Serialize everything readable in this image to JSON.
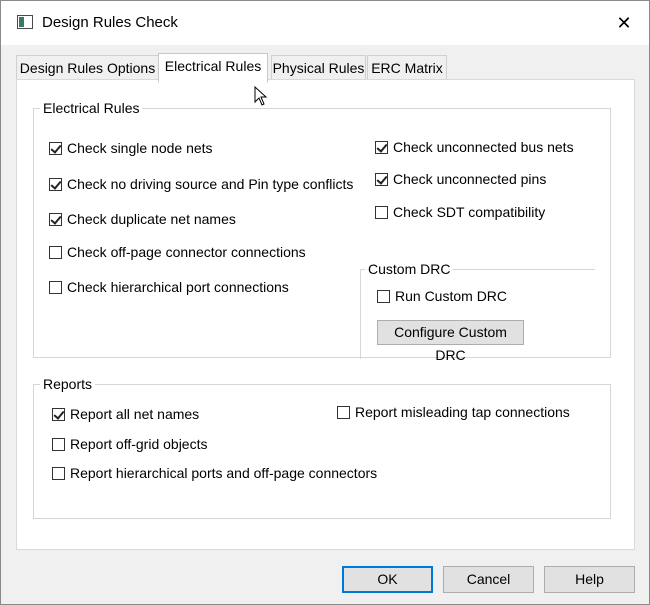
{
  "window": {
    "title": "Design Rules Check",
    "close_glyph": "✕"
  },
  "tabs": [
    {
      "label": "Design Rules Options"
    },
    {
      "label": "Electrical Rules"
    },
    {
      "label": "Physical Rules"
    },
    {
      "label": "ERC Matrix"
    }
  ],
  "electrical": {
    "group_title": "Electrical Rules",
    "left": [
      {
        "label": "Check single node nets",
        "checked": true
      },
      {
        "label": "Check no driving source and Pin type conflicts",
        "checked": true
      },
      {
        "label": "Check duplicate net names",
        "checked": true
      },
      {
        "label": "Check off-page connector connections",
        "checked": false
      },
      {
        "label": "Check hierarchical port connections",
        "checked": false
      }
    ],
    "right": [
      {
        "label": "Check unconnected bus nets",
        "checked": true
      },
      {
        "label": "Check unconnected pins",
        "checked": true
      },
      {
        "label": "Check SDT compatibility",
        "checked": false
      }
    ],
    "custom": {
      "group_title": "Custom DRC",
      "run_label": "Run Custom DRC",
      "run_checked": false,
      "configure_label": "Configure Custom DRC"
    }
  },
  "reports": {
    "group_title": "Reports",
    "items": [
      {
        "label": "Report all net names",
        "checked": true
      },
      {
        "label": "Report off-grid objects",
        "checked": false
      },
      {
        "label": "Report hierarchical ports and off-page connectors",
        "checked": false
      },
      {
        "label": "Report misleading tap connections",
        "checked": false
      }
    ]
  },
  "buttons": {
    "ok": "OK",
    "cancel": "Cancel",
    "help": "Help"
  }
}
